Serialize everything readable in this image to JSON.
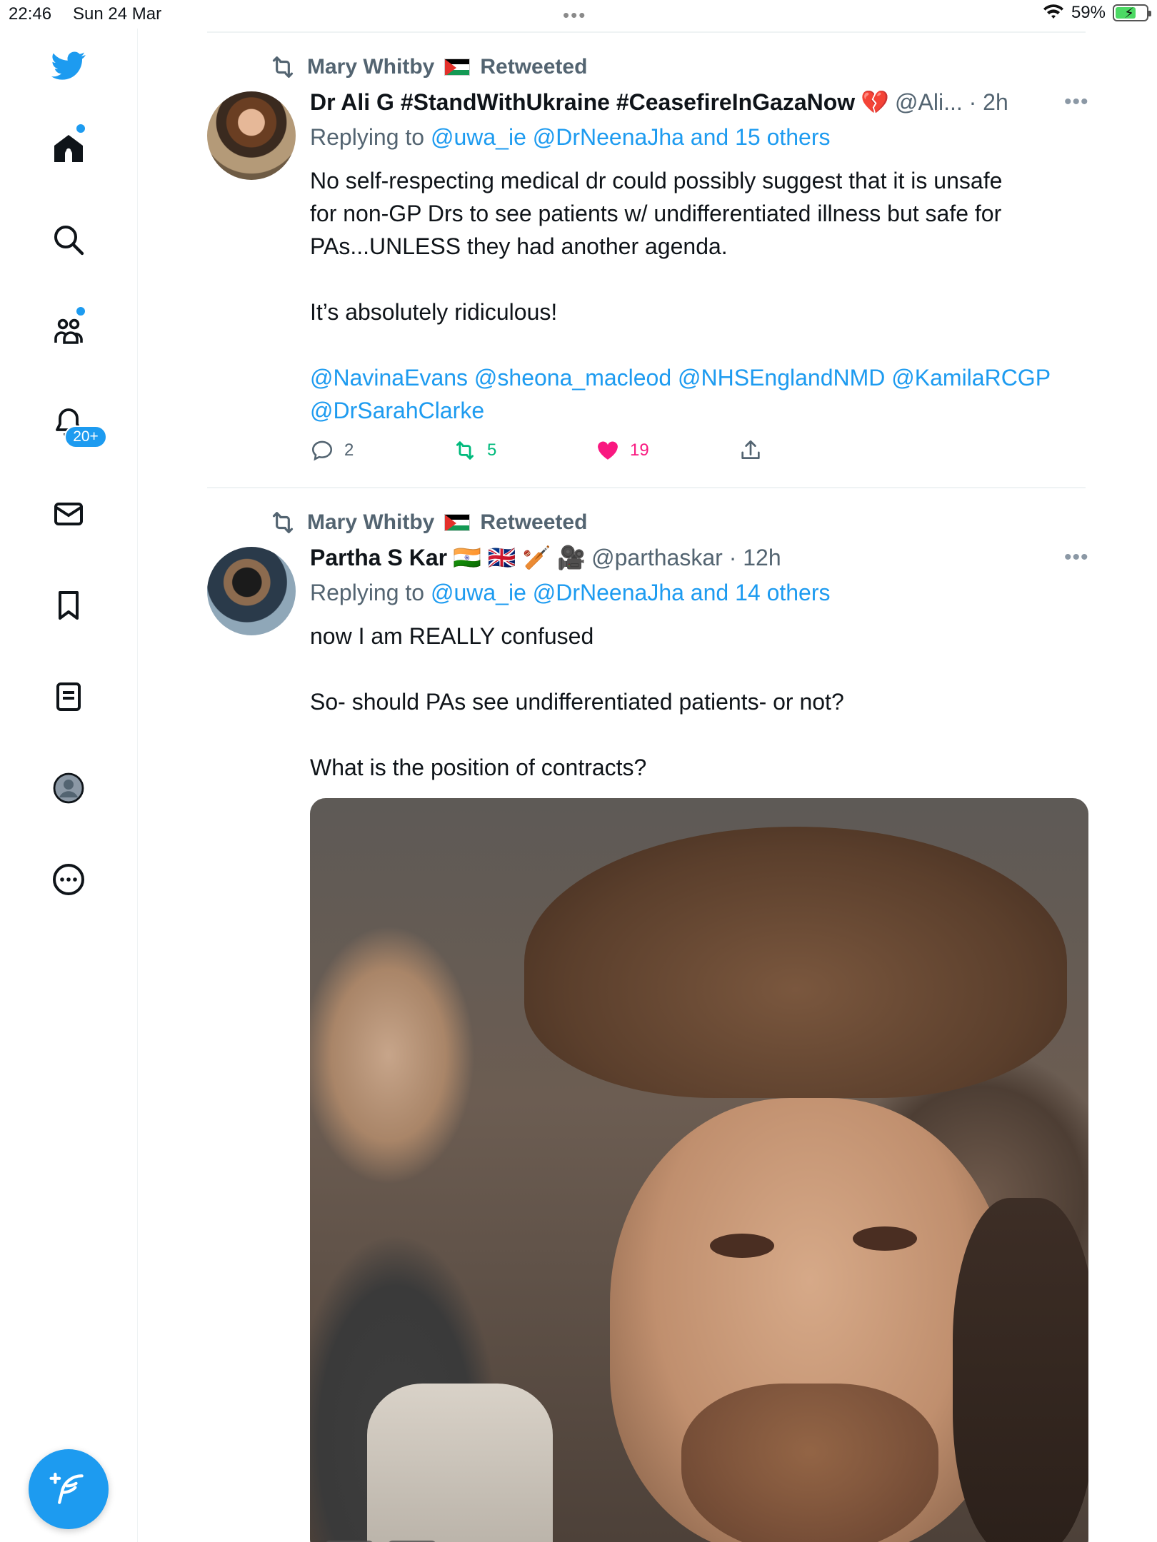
{
  "status_bar": {
    "time": "22:46",
    "date": "Sun 24 Mar",
    "dots": "•••",
    "battery_percent": "59%"
  },
  "sidebar": {
    "notifications_badge": "20+",
    "items": [
      {
        "name": "home",
        "icon": "home-icon"
      },
      {
        "name": "explore",
        "icon": "search-icon"
      },
      {
        "name": "communities",
        "icon": "communities-icon"
      },
      {
        "name": "notifications",
        "icon": "bell-icon"
      },
      {
        "name": "messages",
        "icon": "mail-icon"
      },
      {
        "name": "bookmarks",
        "icon": "bookmark-icon"
      },
      {
        "name": "lists",
        "icon": "list-icon"
      },
      {
        "name": "profile",
        "icon": "profile-icon"
      },
      {
        "name": "more",
        "icon": "more-circle-icon"
      }
    ],
    "accent_color": "#1d9bf0"
  },
  "tweets": [
    {
      "retweeted_by": "Mary Whitby",
      "retweeted_label": "Retweeted",
      "author_name": "Dr Ali G #StandWithUkraine #CeasefireInGazaNow",
      "author_emoji": "💔",
      "handle_time": "@Ali... · 2h",
      "replying_prefix": "Replying to",
      "replying_to": "@uwa_ie @DrNeenaJha and 15 others",
      "text_lines": [
        "No self-respecting medical dr could possibly suggest that it is unsafe",
        "for non-GP Drs to see patients w/ undifferentiated illness but safe for",
        "PAs...UNLESS they had another agenda.",
        "",
        "It’s absolutely ridiculous!",
        ""
      ],
      "mentions_line1": "@NavinaEvans @sheona_macleod @NHSEnglandNMD @KamilaRCGP",
      "mentions_line2": "@DrSarahClarke",
      "replies": "2",
      "retweets": "5",
      "likes": "19",
      "liked": true,
      "retweet_color": "#00ba7c",
      "like_color": "#f91880"
    },
    {
      "retweeted_by": "Mary Whitby",
      "retweeted_label": "Retweeted",
      "author_name": "Partha S Kar",
      "author_emoji": "🇮🇳 🇬🇧 🏏 🎥",
      "handle_time": "@parthaskar · 12h",
      "replying_prefix": "Replying to",
      "replying_to": "@uwa_ie @DrNeenaJha and 14 others",
      "text_lines": [
        "now I am REALLY confused",
        "",
        "So- should PAs see undifferentiated patients- or not?",
        "",
        "What is the position of contracts?"
      ],
      "media": "gif-image"
    }
  ]
}
